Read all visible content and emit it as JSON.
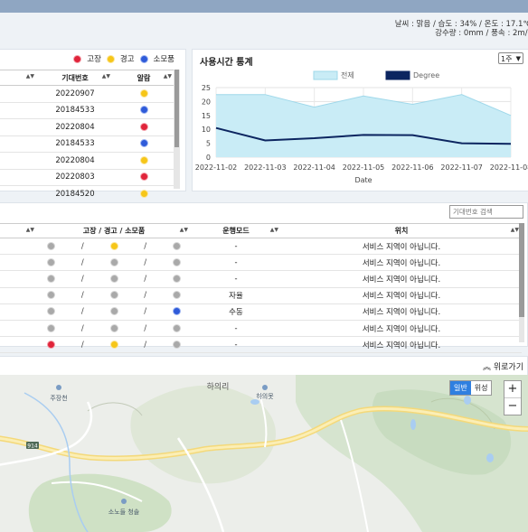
{
  "weather": {
    "line1": "날씨 : 맑음 / 습도 : 34% / 온도 : 17.1℃",
    "line2": "강수량 : 0mm / 풍속 : 2m/s"
  },
  "alarm_panel": {
    "legend": [
      "고장",
      "경고",
      "소모품"
    ],
    "columns": [
      "",
      "기대번호",
      "알람"
    ],
    "rows": [
      {
        "id": "20220907",
        "status": "yellow"
      },
      {
        "id": "20184533",
        "status": "blue"
      },
      {
        "id": "20220804",
        "status": "red"
      },
      {
        "id": "20184533",
        "status": "blue"
      },
      {
        "id": "20220804",
        "status": "yellow"
      },
      {
        "id": "20220803",
        "status": "red"
      },
      {
        "id": "20184520",
        "status": "yellow"
      },
      {
        "id": "20184520",
        "status": "blue"
      }
    ]
  },
  "chart_panel": {
    "title": "사용시간 통계",
    "period_select": "1주"
  },
  "chart_data": {
    "type": "line",
    "x": [
      "2022-11-02",
      "2022-11-03",
      "2022-11-04",
      "2022-11-05",
      "2022-11-06",
      "2022-11-07",
      "2022-11-08"
    ],
    "series": [
      {
        "name": "전제",
        "type": "area",
        "values": [
          22.5,
          22.5,
          18,
          22,
          19,
          22.5,
          15
        ],
        "color": "#c9ecf6"
      },
      {
        "name": "Degree",
        "type": "line",
        "values": [
          10.5,
          6,
          6.8,
          8,
          7.9,
          5,
          4.8
        ],
        "color": "#0c2560"
      }
    ],
    "xlabel": "Date",
    "ylim": [
      0,
      25
    ],
    "yticks": [
      0,
      5,
      10,
      15,
      20,
      25
    ],
    "grid": true,
    "legend": "top-center"
  },
  "vehicle_panel": {
    "search_placeholder": "기대번호 검색",
    "columns": [
      "",
      "고장 / 경고 / 소모품",
      "운행모드",
      "위치"
    ],
    "rows": [
      {
        "fault": "gray",
        "warn": "yellow",
        "consumable": "gray",
        "mode": "-",
        "location": "서비스 지역이 아닙니다."
      },
      {
        "fault": "gray",
        "warn": "gray",
        "consumable": "gray",
        "mode": "-",
        "location": "서비스 지역이 아닙니다."
      },
      {
        "fault": "gray",
        "warn": "gray",
        "consumable": "gray",
        "mode": "-",
        "location": "서비스 지역이 아닙니다."
      },
      {
        "fault": "gray",
        "warn": "gray",
        "consumable": "gray",
        "mode": "자율",
        "location": "서비스 지역이 아닙니다."
      },
      {
        "fault": "gray",
        "warn": "gray",
        "consumable": "blue",
        "mode": "수동",
        "location": "서비스 지역이 아닙니다."
      },
      {
        "fault": "gray",
        "warn": "gray",
        "consumable": "gray",
        "mode": "-",
        "location": "서비스 지역이 아닙니다."
      },
      {
        "fault": "red",
        "warn": "yellow",
        "consumable": "gray",
        "mode": "-",
        "location": "서비스 지역이 아닙니다."
      },
      {
        "fault": "red",
        "warn": "gray",
        "consumable": "gray",
        "mode": "-",
        "location": "서비스 지역이 아닙니다."
      }
    ]
  },
  "map_panel": {
    "back_to_top": "위로가기",
    "map_type": [
      "일반",
      "위성"
    ],
    "zoom_in": "+",
    "zoom_out": "−",
    "labels": {
      "jujang": "주장천",
      "haui_ri": "하의리",
      "haui_pond": "하의못",
      "road_no": "914",
      "sonodeul": "소노들 청솔"
    }
  }
}
